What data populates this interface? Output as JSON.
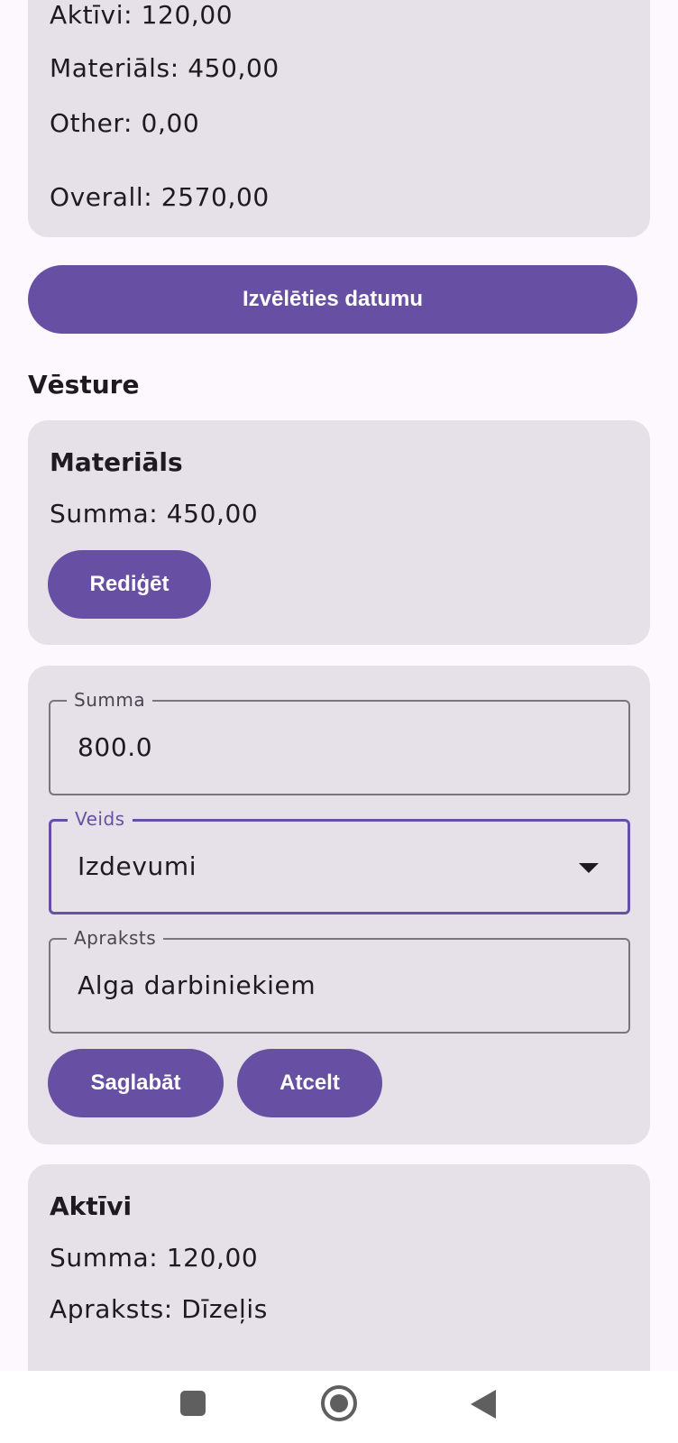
{
  "summary": {
    "assets_line": "Aktīvi: 120,00",
    "materials_line": "Materiāls: 450,00",
    "other_line": "Other: 0,00",
    "overall_line": "Overall: 2570,00"
  },
  "pick_date_button": "Izvēlēties datumu",
  "history_title": "Vēsture",
  "history": [
    {
      "title": "Materiāls",
      "amount_line": "Summa: 450,00",
      "edit_button": "Rediģēt"
    },
    {
      "title": "Aktīvi",
      "amount_line": "Summa: 120,00",
      "description_line": "Apraksts: Dīzeļis"
    }
  ],
  "edit_form": {
    "amount": {
      "label": "Summa",
      "value": "800.0"
    },
    "type": {
      "label": "Veids",
      "value": "Izdevumi"
    },
    "description": {
      "label": "Apraksts",
      "value": "Alga darbiniekiem"
    },
    "save_button": "Saglabāt",
    "cancel_button": "Atcelt"
  },
  "colors": {
    "primary": "#6750a4",
    "card": "#e6e0e8",
    "background": "#fdf7fe"
  },
  "icons": {
    "nav_recents": "square-icon",
    "nav_home": "home-circle-icon",
    "nav_back": "back-triangle-icon",
    "dropdown": "caret-down-icon"
  }
}
